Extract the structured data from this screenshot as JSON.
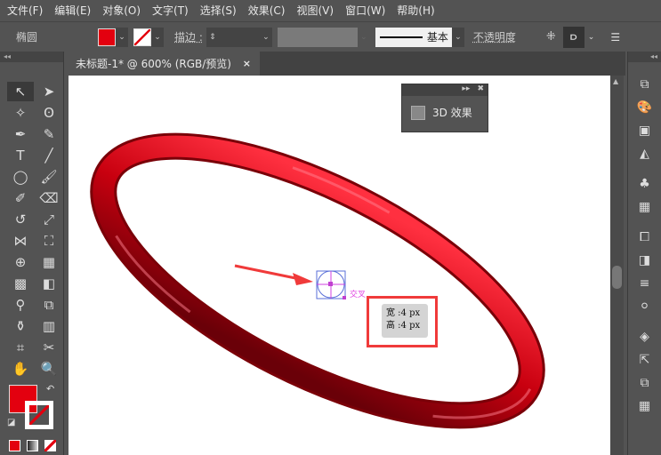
{
  "menu": [
    "文件(F)",
    "编辑(E)",
    "对象(O)",
    "文字(T)",
    "选择(S)",
    "效果(C)",
    "视图(V)",
    "窗口(W)",
    "帮助(H)"
  ],
  "control": {
    "object_type": "椭圆",
    "fill_color": "#e3000f",
    "stroke_label": "描边 :",
    "line_style": "基本",
    "opacity_label": "不透明度"
  },
  "tab": {
    "title": "未标题-1* @ 600% (RGB/预览)",
    "close": "×"
  },
  "panel3d": {
    "label": "3D 效果"
  },
  "canvas": {
    "snap_label": "交叉",
    "width_label": "宽 :4 px",
    "height_label": "高 :4 px",
    "ring_color": "#c8000f"
  }
}
